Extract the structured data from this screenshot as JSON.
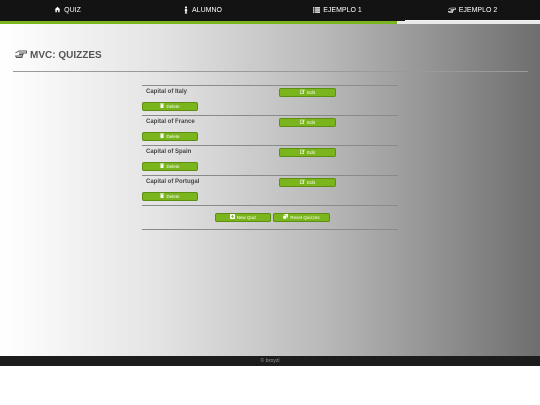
{
  "nav": {
    "tabs": [
      {
        "label": "QUIZ",
        "icon": "home-icon"
      },
      {
        "label": "ALUMNO",
        "icon": "student-icon"
      },
      {
        "label": "EJEMPLO 1",
        "icon": "list-icon"
      },
      {
        "label": "EJEMPLO 2",
        "icon": "pointing-hand-icon"
      }
    ],
    "active_tab": "EJEMPLO 2"
  },
  "page": {
    "title": "MVC: QUIZZES",
    "icon": "pointing-hand-icon"
  },
  "quizzes": [
    {
      "question": "Capital of Italy",
      "edit_label": "Edit",
      "delete_label": "Delete"
    },
    {
      "question": "Capital of France",
      "edit_label": "Edit",
      "delete_label": "Delete"
    },
    {
      "question": "Capital of Spain",
      "edit_label": "Edit",
      "delete_label": "Delete"
    },
    {
      "question": "Capital of Portugal",
      "edit_label": "Edit",
      "delete_label": "Delete"
    }
  ],
  "actions": {
    "new_quiz_label": "New Quiz",
    "reset_label": "Reset Quizzes"
  },
  "footer": {
    "text": "© bxxyzl"
  },
  "colors": {
    "accent": "#7ab51d",
    "nav_background": "#131313",
    "text": "#555555"
  }
}
